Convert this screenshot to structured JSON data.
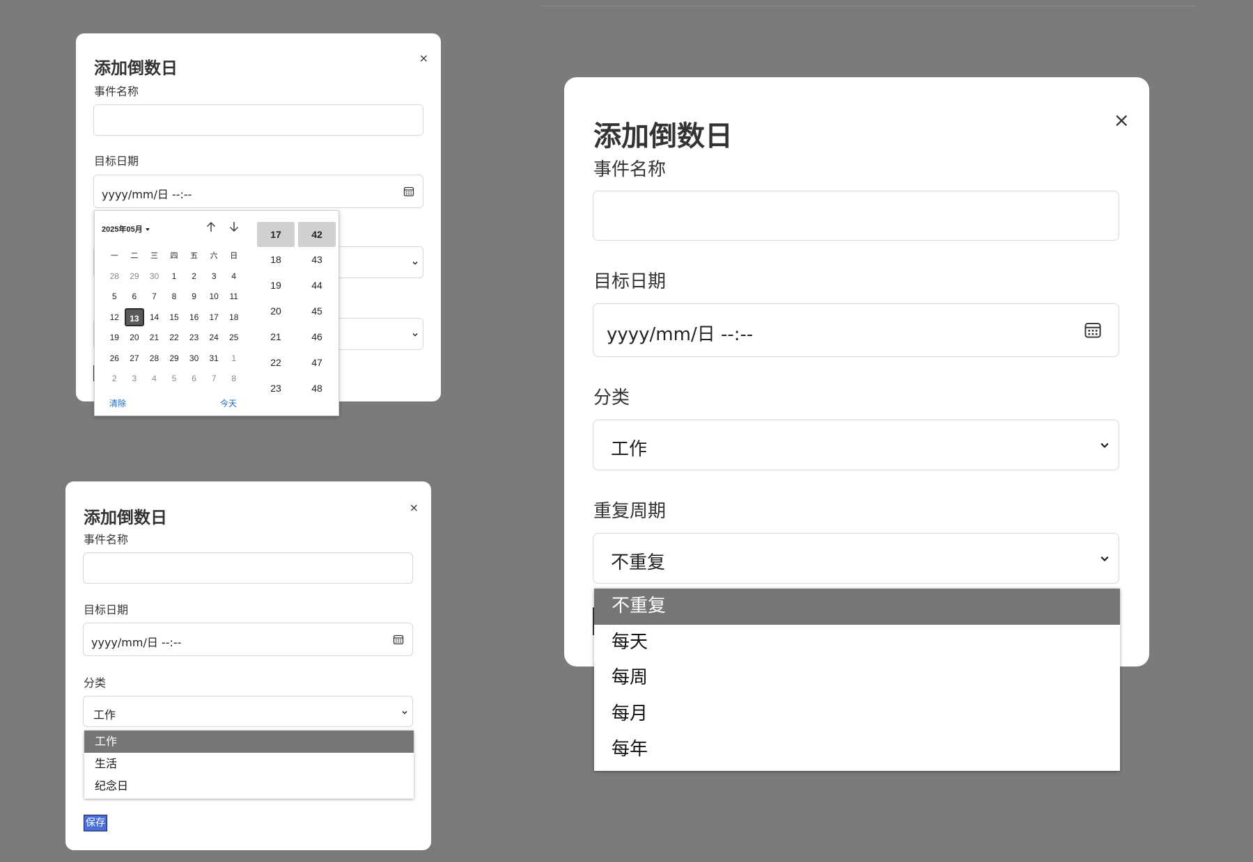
{
  "dialog": {
    "title": "添加倒数日",
    "close_label": "×",
    "event_name_label": "事件名称",
    "event_name_value": "",
    "target_date_label": "目标日期",
    "target_date_placeholder": "yyyy/mm/日  --:--",
    "category_label": "分类",
    "category_value": "工作",
    "repeat_label": "重复周期",
    "repeat_value": "不重复",
    "save_label": "保存"
  },
  "calendar": {
    "month_label": "2025年05月",
    "weekdays": [
      "一",
      "二",
      "三",
      "四",
      "五",
      "六",
      "日"
    ],
    "weeks": [
      [
        {
          "d": "28",
          "dim": true
        },
        {
          "d": "29",
          "dim": true
        },
        {
          "d": "30",
          "dim": true
        },
        {
          "d": "1"
        },
        {
          "d": "2"
        },
        {
          "d": "3"
        },
        {
          "d": "4"
        }
      ],
      [
        {
          "d": "5"
        },
        {
          "d": "6"
        },
        {
          "d": "7"
        },
        {
          "d": "8"
        },
        {
          "d": "9"
        },
        {
          "d": "10"
        },
        {
          "d": "11"
        }
      ],
      [
        {
          "d": "12"
        },
        {
          "d": "13",
          "selected": true
        },
        {
          "d": "14"
        },
        {
          "d": "15"
        },
        {
          "d": "16"
        },
        {
          "d": "17"
        },
        {
          "d": "18"
        }
      ],
      [
        {
          "d": "19"
        },
        {
          "d": "20"
        },
        {
          "d": "21"
        },
        {
          "d": "22"
        },
        {
          "d": "23"
        },
        {
          "d": "24"
        },
        {
          "d": "25"
        }
      ],
      [
        {
          "d": "26"
        },
        {
          "d": "27"
        },
        {
          "d": "28"
        },
        {
          "d": "29"
        },
        {
          "d": "30"
        },
        {
          "d": "31"
        },
        {
          "d": "1",
          "dim": true
        }
      ],
      [
        {
          "d": "2",
          "dim": true
        },
        {
          "d": "3",
          "dim": true
        },
        {
          "d": "4",
          "dim": true
        },
        {
          "d": "5",
          "dim": true
        },
        {
          "d": "6",
          "dim": true
        },
        {
          "d": "7",
          "dim": true
        },
        {
          "d": "8",
          "dim": true
        }
      ]
    ],
    "clear_label": "清除",
    "today_label": "今天",
    "hours": [
      "17",
      "18",
      "19",
      "20",
      "21",
      "22",
      "23"
    ],
    "minutes": [
      "42",
      "43",
      "44",
      "45",
      "46",
      "47",
      "48"
    ],
    "selected_hour": "17",
    "selected_minute": "42"
  },
  "category_options": [
    "工作",
    "生活",
    "纪念日"
  ],
  "repeat_options": [
    "不重复",
    "每天",
    "每周",
    "每月",
    "每年"
  ],
  "colors": {
    "backdrop": "#7a7a7a",
    "selected_option": "#767676",
    "link": "#1a66c2",
    "save_button": "#4a6fd6"
  },
  "icons": [
    "close-icon",
    "calendar-icon",
    "chevron-down-icon",
    "arrow-up-icon",
    "arrow-down-icon",
    "caret-down-icon"
  ]
}
